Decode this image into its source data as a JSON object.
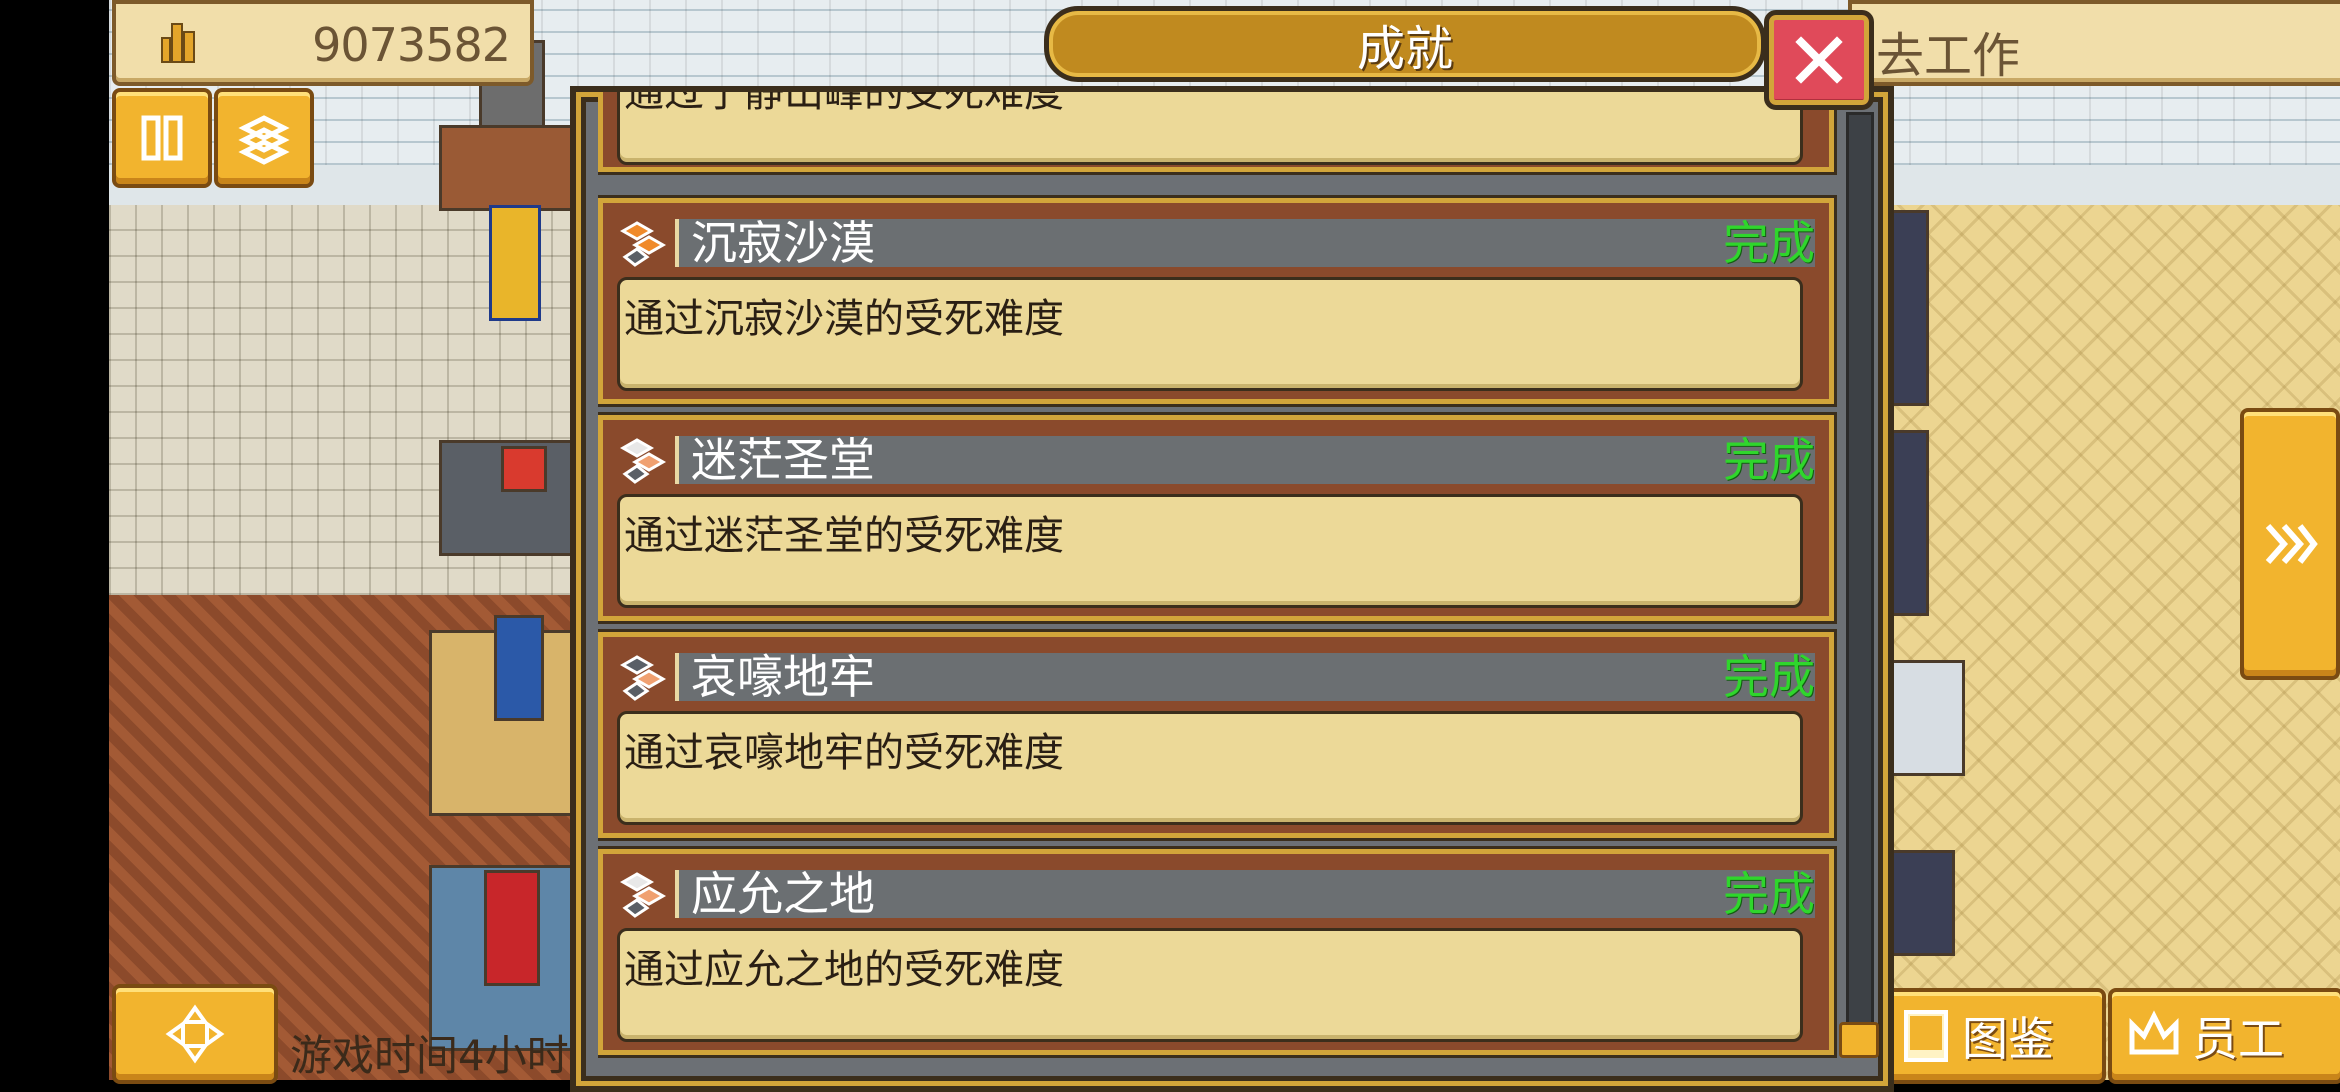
{
  "hud": {
    "money": "9073582",
    "job_text": "去工作",
    "game_time": "游戏时间4小时"
  },
  "bottom_buttons": {
    "guide": "图鉴",
    "staff": "员工"
  },
  "dialog": {
    "title": "成就",
    "achievements": [
      {
        "name": "",
        "description": "通过宁静山峰的受死难度",
        "status": ""
      },
      {
        "name": "沉寂沙漠",
        "description": "通过沉寂沙漠的受死难度",
        "status": "完成"
      },
      {
        "name": "迷茫圣堂",
        "description": "通过迷茫圣堂的受死难度",
        "status": "完成"
      },
      {
        "name": "哀嚎地牢",
        "description": "通过哀嚎地牢的受死难度",
        "status": "完成"
      },
      {
        "name": "应允之地",
        "description": "通过应允之地的受死难度",
        "status": "完成"
      }
    ]
  },
  "colors": {
    "complete": "#2fd62c",
    "gold_button": "#f2b42e",
    "close_button": "#e04a5a"
  }
}
